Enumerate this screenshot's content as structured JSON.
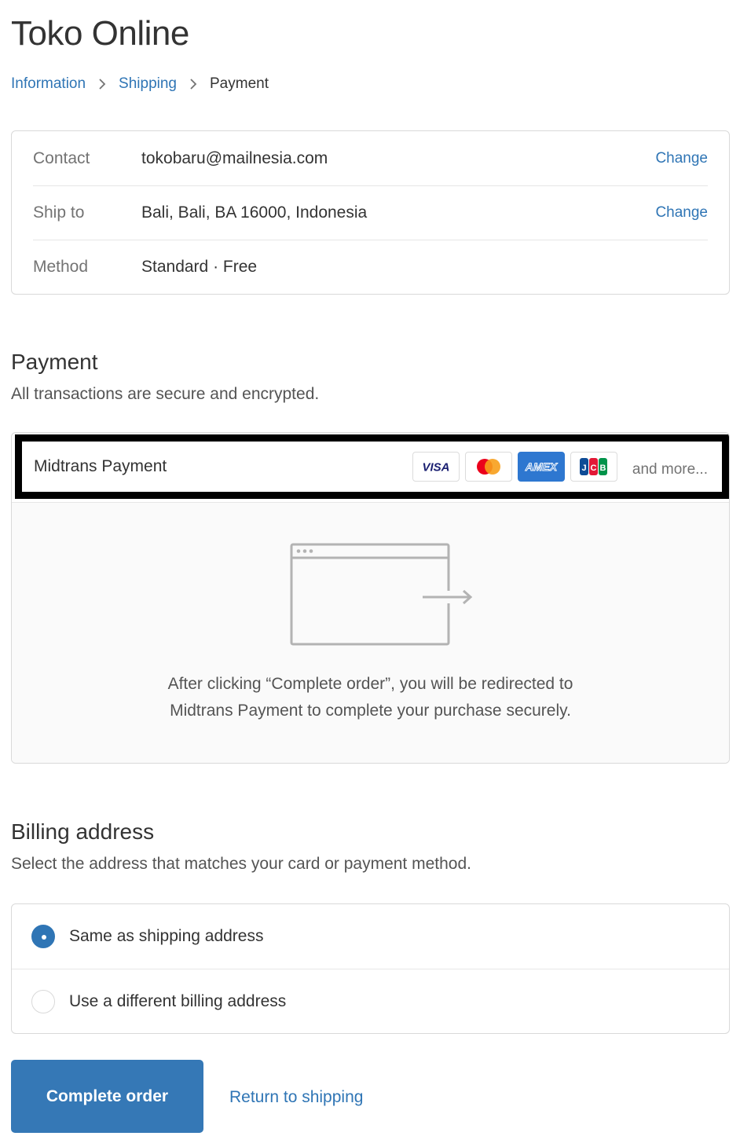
{
  "store": {
    "title": "Toko Online"
  },
  "breadcrumb": {
    "items": [
      {
        "label": "Information"
      },
      {
        "label": "Shipping"
      },
      {
        "label": "Payment"
      }
    ]
  },
  "review": {
    "rows": [
      {
        "label": "Contact",
        "value": "tokobaru@mailnesia.com",
        "action": "Change"
      },
      {
        "label": "Ship to",
        "value": "Bali, Bali, BA 16000, Indonesia",
        "action": "Change"
      },
      {
        "label": "Method",
        "value": "Standard · Free"
      }
    ]
  },
  "payment": {
    "title": "Payment",
    "subtitle": "All transactions are secure and encrypted.",
    "gateway_name": "Midtrans Payment",
    "cards": [
      {
        "name": "VISA",
        "icon": "visa-icon"
      },
      {
        "name": "Mastercard",
        "icon": "mastercard-icon"
      },
      {
        "name": "AMEX",
        "icon": "amex-icon"
      },
      {
        "name": "JCB",
        "icon": "jcb-icon"
      }
    ],
    "and_more": "and more...",
    "redirect_line1": "After clicking “Complete order”, you will be redirected to",
    "redirect_line2": "Midtrans Payment to complete your purchase securely."
  },
  "billing": {
    "title": "Billing address",
    "subtitle": "Select the address that matches your card or payment method.",
    "options": [
      {
        "label": "Same as shipping address",
        "selected": true
      },
      {
        "label": "Use a different billing address",
        "selected": false
      }
    ]
  },
  "actions": {
    "complete_label": "Complete order",
    "return_label": "Return to shipping"
  },
  "colors": {
    "accent": "#2f75b5",
    "button": "#3578b6",
    "highlight_border": "#000000"
  }
}
